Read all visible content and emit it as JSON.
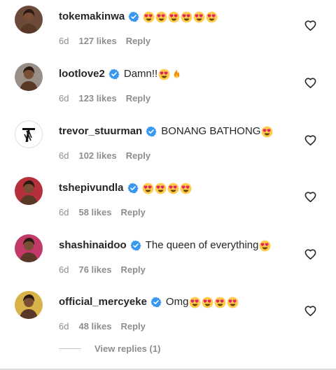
{
  "comments": [
    {
      "username": "tokemakinwa",
      "text": "",
      "emoji_count": 6,
      "emoji_after_text": "heart-eyes",
      "time": "6d",
      "likes": "127 likes",
      "reply": "Reply",
      "avatar_color": "#6b4a3a"
    },
    {
      "username": "lootlove2",
      "text": "Damn!!",
      "emoji_count": 1,
      "extra_emoji": "fire",
      "time": "6d",
      "likes": "123 likes",
      "reply": "Reply",
      "avatar_color": "#9a8f86"
    },
    {
      "username": "trevor_stuurman",
      "text": "BONANG BATHONG",
      "emoji_count": 1,
      "time": "6d",
      "likes": "102 likes",
      "reply": "Reply",
      "avatar_color": "#ffffff"
    },
    {
      "username": "tshepivundla",
      "text": "",
      "emoji_count": 4,
      "time": "6d",
      "likes": "58 likes",
      "reply": "Reply",
      "avatar_color": "#b5303a"
    },
    {
      "username": "shashinaidoo",
      "text": "The queen of everything",
      "emoji_count": 1,
      "time": "6d",
      "likes": "76 likes",
      "reply": "Reply",
      "avatar_color": "#c23a6a"
    },
    {
      "username": "official_mercyeke",
      "text": "Omg",
      "emoji_count": 4,
      "time": "6d",
      "likes": "48 likes",
      "reply": "Reply",
      "avatar_color": "#d8b34a"
    }
  ],
  "view_replies": "View replies (1)",
  "colors": {
    "verified": "#3897f0",
    "secondary_text": "#8e8e8e",
    "primary_text": "#262626"
  },
  "icons": {
    "verified": "verified-badge-icon",
    "like": "heart-outline-icon",
    "emoji": "heart-eyes-emoji",
    "fire": "fire-emoji"
  }
}
